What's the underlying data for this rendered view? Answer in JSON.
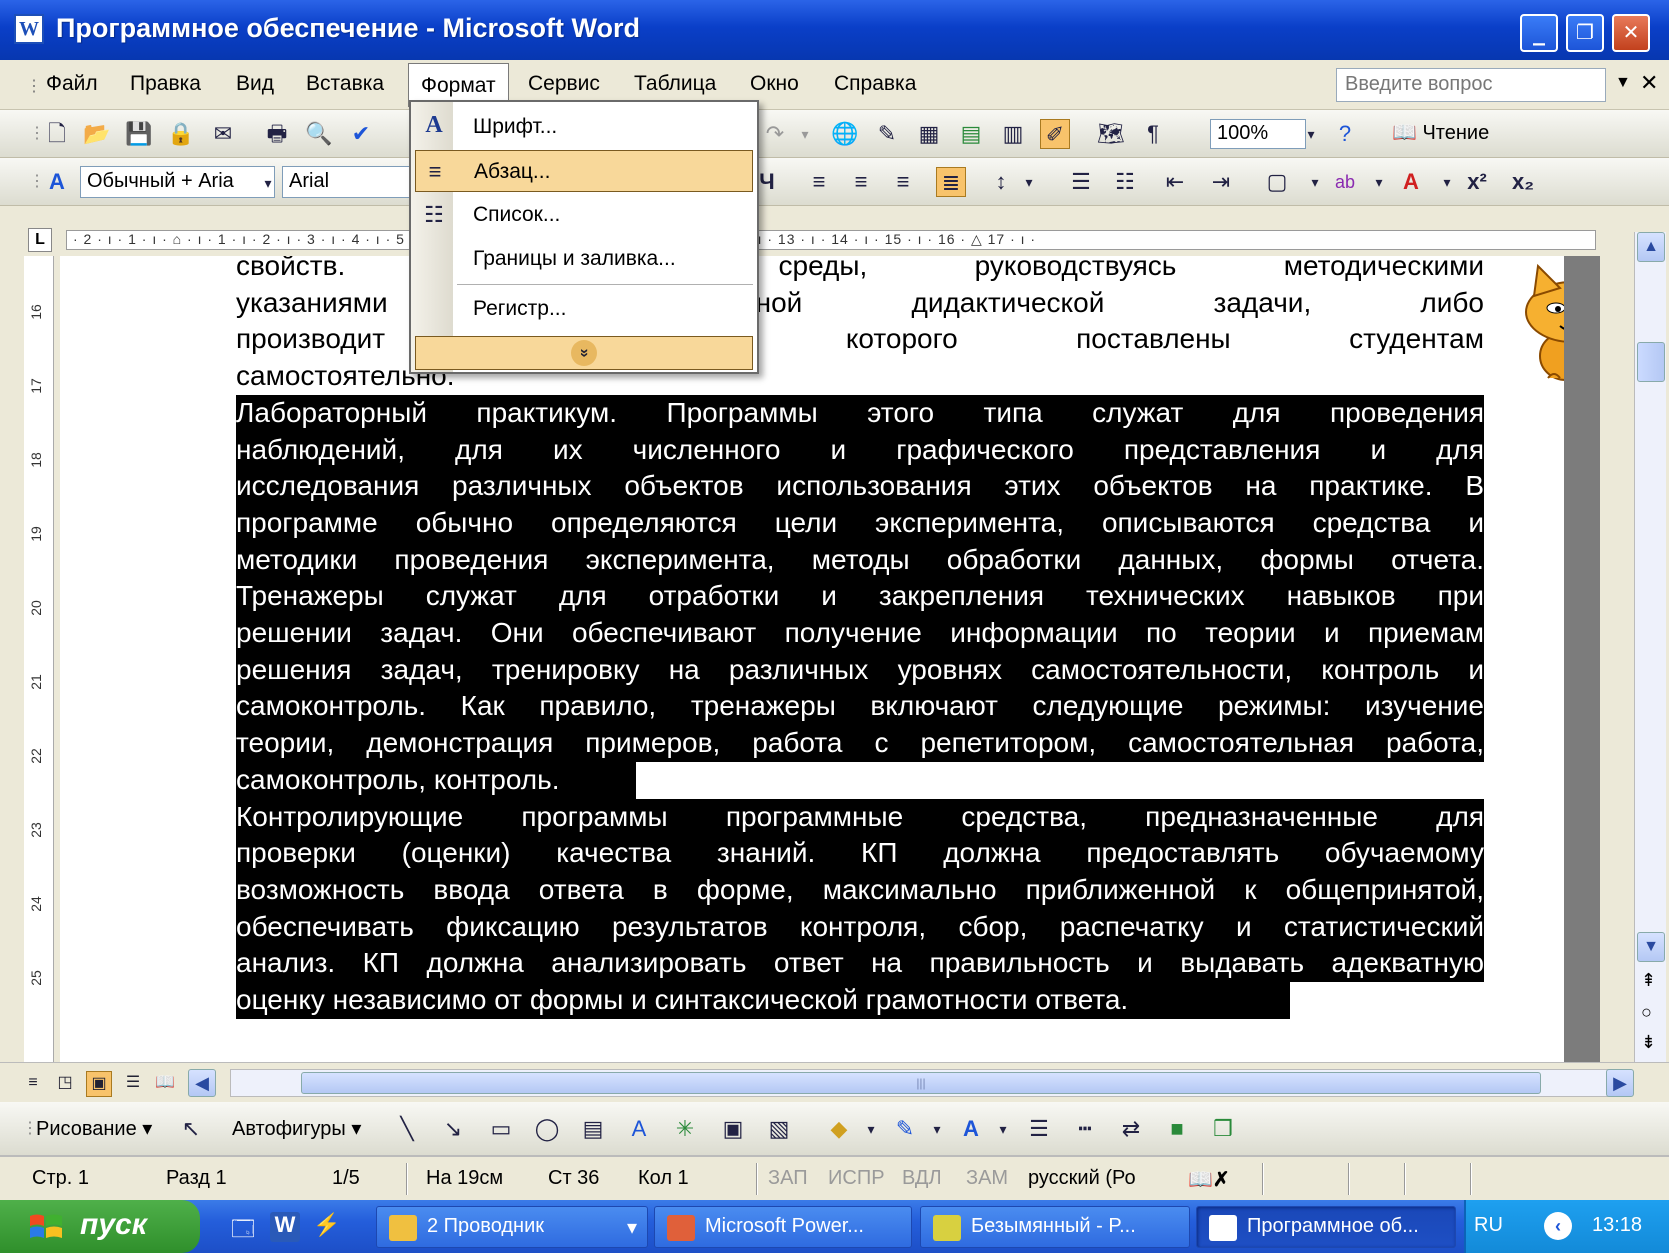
{
  "window": {
    "title": "Программное обеспечение - Microsoft Word",
    "minimize": "_",
    "restore": "❐",
    "close": "✕"
  },
  "menubar": {
    "items": [
      "Файл",
      "Правка",
      "Вид",
      "Вставка",
      "Формат",
      "Сервис",
      "Таблица",
      "Окно",
      "Справка"
    ],
    "active": "Формат",
    "help_placeholder": "Введите вопрос"
  },
  "format_menu": {
    "items": [
      {
        "label": "Шрифт...",
        "icon": "font-icon"
      },
      {
        "label": "Абзац...",
        "icon": "paragraph-icon"
      },
      {
        "label": "Список...",
        "icon": "list-icon"
      },
      {
        "label": "Границы и заливка...",
        "icon": ""
      },
      {
        "label": "Регистр...",
        "icon": ""
      }
    ],
    "highlighted": "Абзац...",
    "more_glyph": "»"
  },
  "standard_toolbar": {
    "zoom": "100%",
    "read_label": "Чтение"
  },
  "formatting_toolbar": {
    "style": "Обычный + Aria",
    "font": "Arial"
  },
  "ruler": {
    "horizontal_marks": "· 2 · ı · 1 · ı · ⌂ · ı · 1 · ı · 2 · ı · 3 · ı · 4 · ı · 5 · ı · 6 · ı · 7 · ı · 8 · ı · 9 · ı · 10 · ı · 11 · ı · 12 · ı · 13 · ı · 14 · ı · 15 · ı · 16 · △ 17 · ı ·",
    "vertical_marks": [
      "16",
      "17",
      "18",
      "19",
      "20",
      "21",
      "22",
      "23",
      "24",
      "25"
    ]
  },
  "document": {
    "lines_top": [
      {
        "text": "свойств. С                                    ектами среды, руководствуясь методическими",
        "justify": true
      },
      {
        "text": "указаниями                          я поставленной дидактической задачи, либо",
        "justify": true
      },
      {
        "text": "производит                          и задачи которого поставлены студентам",
        "justify": true
      },
      {
        "text": "самостоятельно.",
        "justify": false
      }
    ],
    "lines_sel1": [
      "Лабораторный практикум. Программы этого типа служат для проведения",
      "наблюдений, для их численного и графического представления и для",
      "исследования различных объектов использования этих объектов на практике. В",
      "программе обычно определяются цели эксперимента, описываются средства и",
      "методики проведения эксперимента, методы обработки данных, формы отчета.",
      "Тренажеры служат для отработки и закрепления технических навыков при",
      "решении задач. Они обеспечивают получение информации по теории и приемам",
      "решения задач, тренировку на различных уровнях самостоятельности, контроль и",
      "самоконтроль. Как правило, тренажеры включают следующие режимы: изучение",
      "теории, демонстрация примеров, работа с репетитором, самостоятельная работа,"
    ],
    "sel1_last": "самоконтроль, контроль.",
    "lines_sel2": [
      "Контролирующие программы программные средства, предназначенные для",
      "проверки (оценки) качества знаний. КП должна предоставлять обучаемому",
      "возможность ввода ответа в форме, максимально приближенной к общепринятой,",
      "обеспечивать фиксацию результатов контроля, сбор, распечатку и статистический",
      "анализ. КП должна анализировать ответ на правильность и выдавать адекватную"
    ],
    "sel2_last": "оценку независимо от формы и синтаксической грамотности ответа."
  },
  "drawing_toolbar": {
    "draw_label": "Рисование ▾",
    "autoshapes_label": "Автофигуры ▾"
  },
  "statusbar": {
    "page": "Стр. 1",
    "section": "Разд 1",
    "pages": "1/5",
    "at": "На 19см",
    "line": "Ст 36",
    "col": "Кол 1",
    "rec": "ЗАП",
    "trk": "ИСПР",
    "ext": "ВДЛ",
    "ovr": "ЗАМ",
    "lang": "русский (Ро"
  },
  "taskbar": {
    "start": "пуск",
    "tasks": [
      {
        "label": "2 Проводник",
        "color": "#f0c040"
      },
      {
        "label": "Microsoft Power...",
        "color": "#e0603a"
      },
      {
        "label": "Безымянный - P...",
        "color": "#d8d040"
      },
      {
        "label": "Программное об...",
        "color": "#ffffff"
      }
    ],
    "lang": "RU",
    "time": "13:18"
  }
}
